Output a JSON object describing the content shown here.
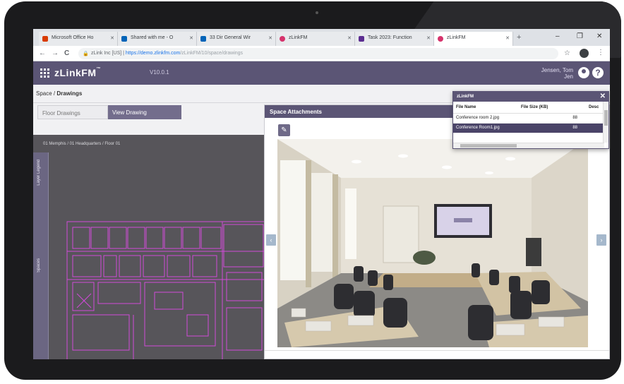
{
  "browser": {
    "tabs": [
      {
        "label": "Microsoft Office Ho",
        "color": "#d83b01",
        "active": false
      },
      {
        "label": "Shared with me - O",
        "color": "#0364b8",
        "active": false
      },
      {
        "label": "33 Dir General Wir",
        "color": "#0364b8",
        "active": false
      },
      {
        "label": "zLinkFM",
        "color": "#d6336c",
        "active": false
      },
      {
        "label": "Task 2023: Function",
        "color": "#5c2d91",
        "active": false
      },
      {
        "label": "zLinkFM",
        "color": "#d6336c",
        "active": true
      }
    ],
    "new_tab": "+",
    "window_controls": [
      "–",
      "❐",
      "✕"
    ],
    "nav": {
      "back": "←",
      "forward": "→",
      "reload": "C"
    },
    "url_site": "zLink Inc [US]",
    "url_host": "https://demo.zlinkfm.com",
    "url_path": "/zLinkFM/10/space/drawings",
    "star": "☆",
    "menu": "⋮"
  },
  "app": {
    "brand": "zLinkFM",
    "brand_mark": "™",
    "version": "V10.0.1",
    "user_line1": "Jensen, Tom",
    "user_line2": "Jen",
    "help": "?"
  },
  "page": {
    "breadcrumb_prefix": "Space / ",
    "breadcrumb_current": "Drawings",
    "tabs": [
      "Floor Drawings",
      "View Drawing"
    ]
  },
  "drawing": {
    "path": "01 Memphis / 01 Headquarters / Floor 01",
    "side_label_top": "Layer Legend",
    "side_label_bottom": "Spaces"
  },
  "attachments": {
    "title": "Space Attachments",
    "prev": "‹",
    "next": "›",
    "tool_icon": "✎"
  },
  "popup": {
    "title": "zLinkFM",
    "close": "✕",
    "columns": [
      "File Name",
      "File Size (KB)",
      "Desc"
    ],
    "rows": [
      {
        "name": "Conference room 2.jpg",
        "size": "88",
        "selected": false
      },
      {
        "name": "Conference Room1.jpg",
        "size": "88",
        "selected": true
      }
    ]
  },
  "colors": {
    "header": "#5b5575",
    "accent_tab": "#736d8c",
    "drawing_bg": "#57555a",
    "floorplan_lines": "#d04ad8"
  }
}
